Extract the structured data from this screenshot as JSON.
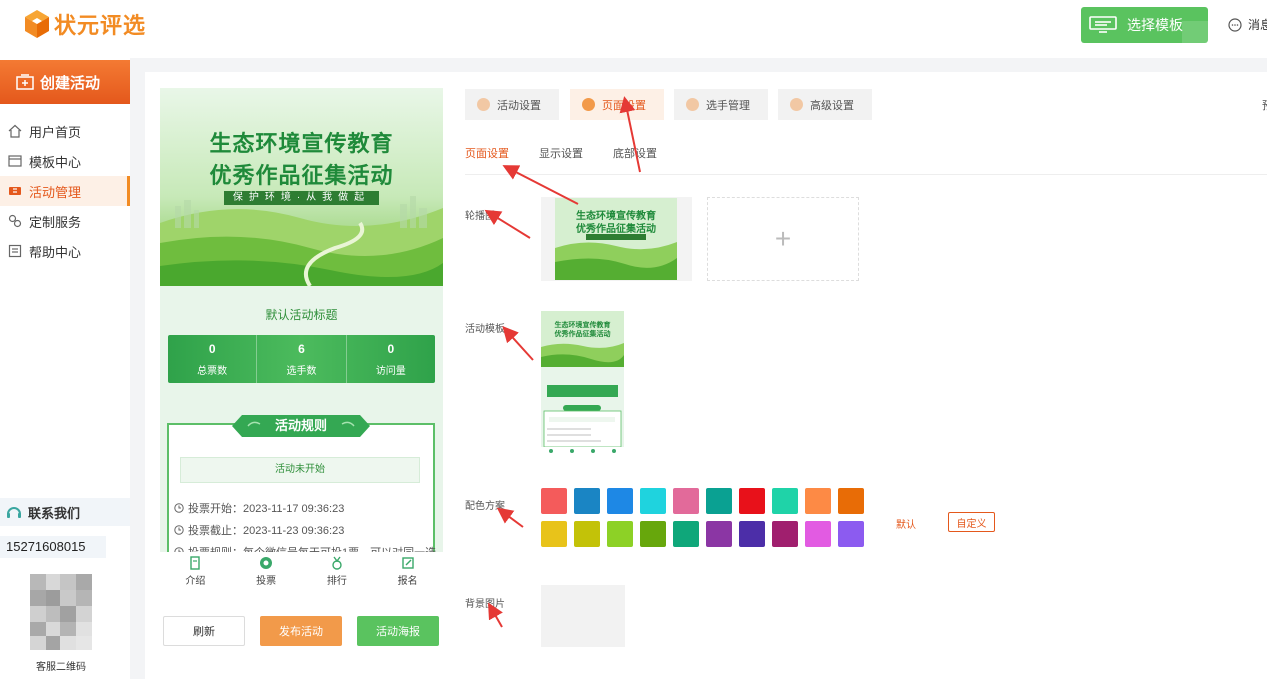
{
  "header": {
    "logo_text": "状元评选",
    "template_button": "选择模板",
    "message_label": "消息"
  },
  "sidebar": {
    "create_label": "创建活动",
    "items": [
      {
        "label": "用户首页",
        "icon": "home-icon"
      },
      {
        "label": "模板中心",
        "icon": "folder-icon"
      },
      {
        "label": "活动管理",
        "icon": "ticket-icon",
        "active": true
      },
      {
        "label": "定制服务",
        "icon": "puzzle-icon"
      },
      {
        "label": "帮助中心",
        "icon": "help-icon"
      }
    ],
    "contact_label": "联系我们",
    "phone": "15271608015",
    "qr_label": "客服二维码"
  },
  "preview": {
    "banner_line1": "生态环境宣传教育",
    "banner_line2": "优秀作品征集活动",
    "banner_sub": "保护环境·从我做起",
    "title": "默认活动标题",
    "stats": [
      {
        "value": "0",
        "label": "总票数"
      },
      {
        "value": "6",
        "label": "选手数"
      },
      {
        "value": "0",
        "label": "访问量"
      }
    ],
    "rules_title": "活动规则",
    "status": "活动未开始",
    "rules": [
      "投票开始：2023-11-17 09:36:23",
      "投票截止：2023-11-23 09:36:23",
      "投票规则：每个微信号每天可投1票，可以对同一选"
    ],
    "tabs": [
      {
        "label": "介绍",
        "icon": "intro-icon"
      },
      {
        "label": "投票",
        "icon": "vote-icon"
      },
      {
        "label": "排行",
        "icon": "rank-icon"
      },
      {
        "label": "报名",
        "icon": "signup-icon"
      }
    ],
    "buttons": {
      "refresh": "刷新",
      "publish": "发布活动",
      "poster": "活动海报"
    }
  },
  "steps": [
    {
      "label": "活动设置",
      "active": false
    },
    {
      "label": "页面设置",
      "active": true
    },
    {
      "label": "选手管理",
      "active": false
    },
    {
      "label": "高级设置",
      "active": false
    }
  ],
  "step_cut_text": "预",
  "subtabs": [
    {
      "label": "页面设置",
      "active": true
    },
    {
      "label": "显示设置",
      "active": false
    },
    {
      "label": "底部设置",
      "active": false
    }
  ],
  "fields": {
    "carousel": "轮播图",
    "template": "活动模板",
    "palette": "配色方案",
    "background": "背景图片",
    "add_symbol": "+",
    "palette_default": "默认",
    "palette_custom": "自定义"
  },
  "palette_colors": [
    "#f45b5b",
    "#1a85c4",
    "#1e88e5",
    "#1fd3de",
    "#e26a9a",
    "#0aa192",
    "#e8111a",
    "#1fd3a8",
    "#fd8a45",
    "#e86c06",
    "#e8c31a",
    "#c3c208",
    "#8dd126",
    "#67a70c",
    "#0fa77a",
    "#8b36a4",
    "#4c2ea8",
    "#a01f6e",
    "#e25be2",
    "#8c5bf0"
  ]
}
